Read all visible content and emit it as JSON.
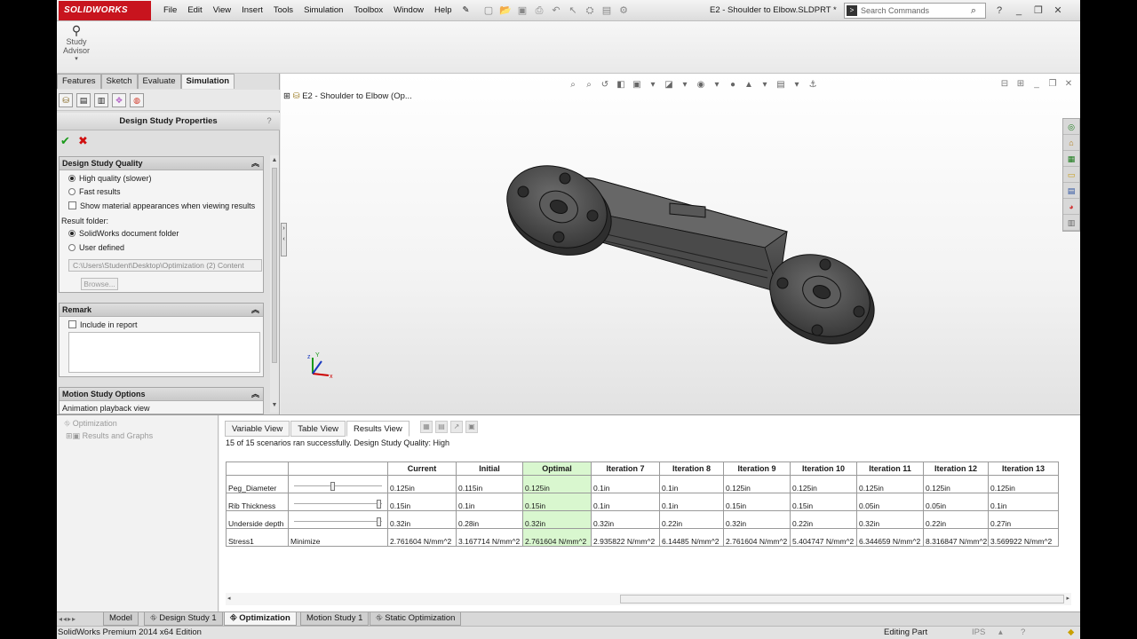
{
  "app": {
    "logo_text": "SOLIDWORKS",
    "menus": [
      "File",
      "Edit",
      "View",
      "Insert",
      "Tools",
      "Simulation",
      "Toolbox",
      "Window",
      "Help"
    ],
    "document_title": "E2 - Shoulder to Elbow.SLDPRT *",
    "search_placeholder": "Search Commands"
  },
  "command_manager": {
    "study_advisor_line1": "Study",
    "study_advisor_line2": "Advisor"
  },
  "left_tabs": [
    "Features",
    "Sketch",
    "Evaluate",
    "Simulation"
  ],
  "property_manager": {
    "title": "Design Study Properties",
    "help": "?",
    "quality_group": {
      "title": "Design Study Quality",
      "high_quality": "High quality (slower)",
      "fast_results": "Fast results",
      "show_material": "Show material appearances when viewing results",
      "result_folder_label": "Result folder:",
      "solidworks_folder": "SolidWorks document folder",
      "user_defined": "User defined",
      "path": "C:\\Users\\Student\\Desktop\\Optimization (2) Content",
      "browse": "Browse..."
    },
    "remark_group": {
      "title": "Remark",
      "include_in_report": "Include in report"
    },
    "motion_group": {
      "title": "Motion Study Options",
      "animation_playback": "Animation playback view"
    }
  },
  "graphics": {
    "feature_tree_root": "E2 - Shoulder to Elbow  (Op..."
  },
  "optimization_tree": {
    "root": "Optimization",
    "child": "Results and Graphs"
  },
  "results_panel": {
    "view_tabs": [
      "Variable View",
      "Table View",
      "Results View"
    ],
    "status_message": "15 of 15 scenarios ran successfully. Design Study Quality: High",
    "columns": [
      "Current",
      "Initial",
      "Optimal",
      "Iteration 7",
      "Iteration 8",
      "Iteration 9",
      "Iteration 10",
      "Iteration 11",
      "Iteration 12",
      "Iteration 13"
    ],
    "rows": [
      {
        "name": "Peg_Diameter",
        "control": "",
        "slider": 0.45,
        "values": [
          "0.125in",
          "0.115in",
          "0.125in",
          "0.1in",
          "0.1in",
          "0.125in",
          "0.125in",
          "0.125in",
          "0.125in",
          "0.125in"
        ]
      },
      {
        "name": "Rib Thickness",
        "control": "",
        "slider": 0.98,
        "values": [
          "0.15in",
          "0.1in",
          "0.15in",
          "0.1in",
          "0.1in",
          "0.15in",
          "0.15in",
          "0.05in",
          "0.05in",
          "0.1in"
        ]
      },
      {
        "name": "Underside depth",
        "control": "",
        "slider": 0.98,
        "values": [
          "0.32in",
          "0.28in",
          "0.32in",
          "0.32in",
          "0.22in",
          "0.32in",
          "0.22in",
          "0.32in",
          "0.22in",
          "0.27in"
        ]
      },
      {
        "name": "Stress1",
        "control": "Minimize",
        "slider": null,
        "values": [
          "2.761604 N/mm^2",
          "3.167714 N/mm^2",
          "2.761604 N/mm^2",
          "2.935822 N/mm^2",
          "6.14485 N/mm^2",
          "2.761604 N/mm^2",
          "5.404747 N/mm^2",
          "6.344659 N/mm^2",
          "8.316847 N/mm^2",
          "3.569922 N/mm^2"
        ]
      }
    ]
  },
  "bottom_tabs": [
    "Model",
    "Design Study 1",
    "Optimization",
    "Motion Study 1",
    "Static Optimization"
  ],
  "status_bar": {
    "edition": "SolidWorks Premium 2014 x64 Edition",
    "mode": "Editing Part",
    "units": "IPS"
  },
  "colors": {
    "brand_red": "#c8141e",
    "optimal_highlight": "#d9f7cf",
    "part_gray": "#5a5a5a"
  }
}
